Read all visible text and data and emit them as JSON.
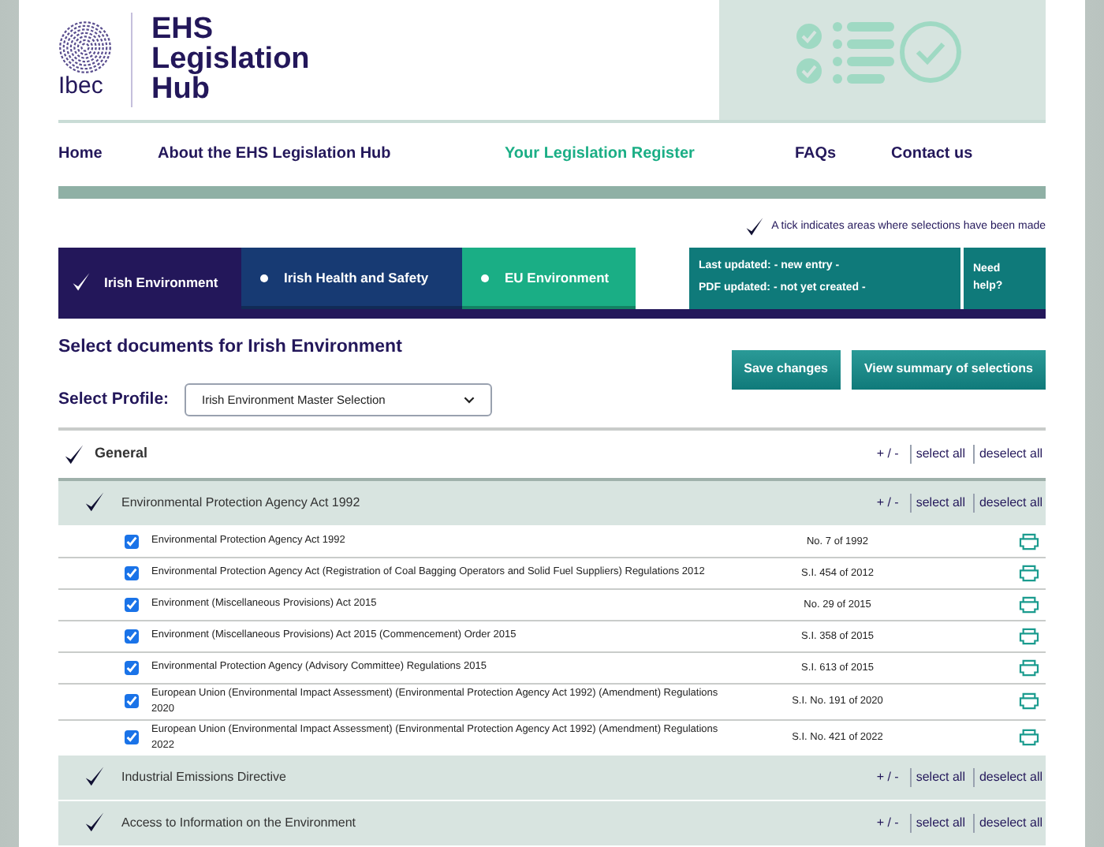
{
  "brand": {
    "logo": "Ibec",
    "title_lines": [
      "EHS",
      "Legislation",
      "Hub"
    ]
  },
  "nav": [
    {
      "label": "Home",
      "selected": false
    },
    {
      "label": "About the EHS Legislation Hub",
      "selected": false
    },
    {
      "label": "Your Legislation Register",
      "selected": true
    },
    {
      "label": "FAQs",
      "selected": false
    },
    {
      "label": "Contact us",
      "selected": false
    }
  ],
  "tick_note": "A tick indicates areas where selections have been made",
  "tabs": [
    {
      "label": "Irish Environment",
      "selected": true,
      "ticked": true,
      "color": "#23175a"
    },
    {
      "label": "Irish Health and Safety",
      "selected": false,
      "ticked": false,
      "color": "#173a73"
    },
    {
      "label": "EU Environment",
      "selected": false,
      "ticked": false,
      "color": "#1aae85"
    }
  ],
  "status": {
    "lines": [
      "Last updated: - new entry -",
      "PDF updated: - not yet created -"
    ],
    "help": "Need help?"
  },
  "heading": "Select documents for Irish Environment",
  "buttons": [
    "Save changes",
    "View summary of selections"
  ],
  "profile": {
    "label": "Select Profile:",
    "value": "Irish Environment Master Selection"
  },
  "section": {
    "title": "General",
    "ticked": true,
    "actions": [
      "+ / -",
      "select all",
      "deselect all"
    ]
  },
  "groups": [
    {
      "title": "Environmental Protection Agency Act 1992",
      "ticked": true,
      "actions": [
        "+ / -",
        "select all",
        "deselect all"
      ],
      "items": [
        {
          "title": "Environmental Protection Agency Act 1992",
          "ref": "No. 7 of 1992",
          "checked": true
        },
        {
          "title": "Environmental Protection Agency Act (Registration of Coal Bagging Operators and Solid Fuel Suppliers) Regulations 2012",
          "ref": "S.I. 454 of 2012",
          "checked": true
        },
        {
          "title": "Environment (Miscellaneous Provisions) Act 2015",
          "ref": "No. 29 of 2015",
          "checked": true
        },
        {
          "title": "Environment (Miscellaneous Provisions) Act 2015 (Commencement) Order 2015",
          "ref": "S.I. 358 of 2015",
          "checked": true
        },
        {
          "title": "Environmental Protection Agency (Advisory Committee) Regulations 2015",
          "ref": "S.I. 613 of 2015",
          "checked": true
        },
        {
          "title": "European Union (Environmental Impact Assessment) (Environmental Protection Agency Act 1992) (Amendment) Regulations 2020",
          "ref": "S.I. No. 191 of 2020",
          "checked": true
        },
        {
          "title": "European Union (Environmental Impact Assessment) (Environmental Protection Agency Act 1992) (Amendment) Regulations 2022",
          "ref": "S.I. No. 421 of 2022",
          "checked": true
        }
      ]
    },
    {
      "title": "Industrial Emissions Directive",
      "ticked": true,
      "actions": [
        "+ / -",
        "select all",
        "deselect all"
      ]
    },
    {
      "title": "Access to Information on the Environment",
      "ticked": true,
      "actions": [
        "+ / -",
        "select all",
        "deselect all"
      ]
    }
  ]
}
